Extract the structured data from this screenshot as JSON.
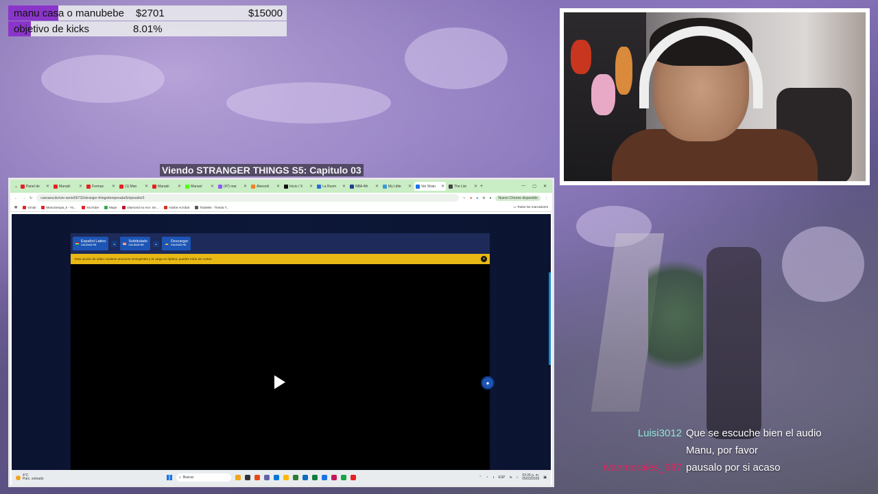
{
  "goals": [
    {
      "label": "manu casa o manubebe",
      "current": "$2701",
      "target": "$15000",
      "progress": 0.18
    },
    {
      "label": "objetivo de kicks",
      "percent": "8.01%",
      "progress": 0.0801
    }
  ],
  "stream_title": "Viendo STRANGER THINGS S5: Capitulo 03",
  "browser": {
    "tabs": [
      {
        "label": "Panel de",
        "color": "#e52222",
        "active": false
      },
      {
        "label": "Manubi",
        "color": "#e52222",
        "active": false
      },
      {
        "label": "Formas",
        "color": "#e52222",
        "active": false
      },
      {
        "label": "(1) Man",
        "color": "#e52222",
        "active": false
      },
      {
        "label": "Manubi",
        "color": "#e52222",
        "active": false
      },
      {
        "label": "Manuel",
        "color": "#53fc18",
        "active": false
      },
      {
        "label": "(47) mar",
        "color": "#8a5cf5",
        "active": false
      },
      {
        "label": "Abecedi",
        "color": "#f48024",
        "active": false
      },
      {
        "label": "Inicio / X",
        "color": "#111111",
        "active": false
      },
      {
        "label": "La Rusm",
        "color": "#2a6bd9",
        "active": false
      },
      {
        "label": "NBA 4th",
        "color": "#1d428a",
        "active": false
      },
      {
        "label": "My Little",
        "color": "#3a9ad9",
        "active": false
      },
      {
        "label": "Ver Stran",
        "color": "#1a73e8",
        "active": true
      },
      {
        "label": "The List",
        "color": "#444444",
        "active": false
      }
    ],
    "url": "cuevana.biz/ver-serie/66732/stranger-things/temporada/5/episodio/3",
    "chrome_badge": "Nuevo Chrome disponible",
    "bookmarks": [
      {
        "label": "Gmail",
        "color": "#e52222"
      },
      {
        "label": "ManuSenpai_k - Yo...",
        "color": "#e52222"
      },
      {
        "label": "YouTube",
        "color": "#e52222"
      },
      {
        "label": "Maps",
        "color": "#34a853"
      },
      {
        "label": "Diamond no Ace: Se...",
        "color": "#c0102c"
      },
      {
        "label": "Adobe Acrobat",
        "color": "#d93025"
      },
      {
        "label": "TodoMtx - Tienda T...",
        "color": "#555555"
      }
    ],
    "all_bookmarks": "Todos los marcadores",
    "player": {
      "servers": [
        {
          "label": "Español Latino",
          "quality": "CALIDAD HD",
          "flag": "mx",
          "has_dropdown": true
        },
        {
          "label": "Subtitulado",
          "quality": "CALIDAD HD",
          "flag": "us",
          "has_dropdown": true
        },
        {
          "label": "Descargar",
          "quality": "CALIDAD HD",
          "flag": "cloud",
          "has_dropdown": false
        }
      ],
      "warning": "Esta opción de vídeo contiene anuncios emergentes y la carga es óptima, puedes mirar sin cortes."
    },
    "taskbar": {
      "weather_temp": "4°C",
      "weather_desc": "Parc. soleado",
      "search_placeholder": "Buscar",
      "apps": [
        "#f3a31c",
        "#333333",
        "#e64a19",
        "#6264a7",
        "#0078d4",
        "#ffb900",
        "#2e7d32",
        "#0f6cbd",
        "#107c41",
        "#1a73e8",
        "#c2185b",
        "#16a34a",
        "#e52222"
      ],
      "lang": "ESP",
      "time": "03:26 p. m.",
      "date": "05/03/2026"
    }
  },
  "chat": [
    {
      "user": "Luisi3012",
      "color": "#8ee6d4",
      "message": "Que se escuche bien el audio"
    },
    {
      "user": "",
      "color": "#ffffff",
      "message": "Manu, por favor"
    },
    {
      "user": "ivanmorales_987",
      "color": "#e0245e",
      "message": "pausalo por si acaso"
    }
  ]
}
